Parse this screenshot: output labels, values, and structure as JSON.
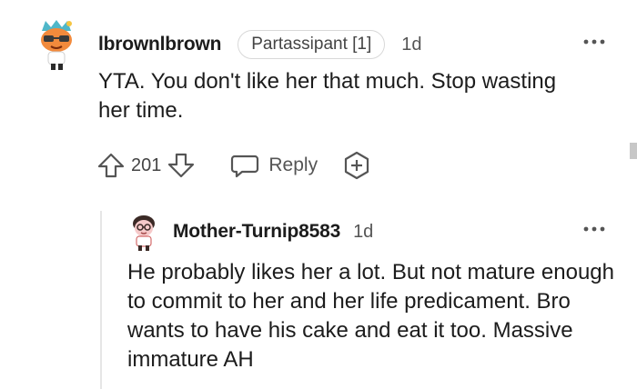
{
  "top_comment": {
    "author": "lbrownlbrown",
    "flair": "Partassipant [1]",
    "age": "1d",
    "body": "YTA. You don't like her that much. Stop wasting her time.",
    "upvote_icon": "arrow-up-outline-icon",
    "vote_count": "201",
    "downvote_icon": "arrow-down-outline-icon",
    "reply_icon": "speech-bubble-icon",
    "reply_label": "Reply",
    "award_icon": "award-plus-icon",
    "more_icon": "ellipsis-icon"
  },
  "reply_comment": {
    "author": "Mother-Turnip8583",
    "age": "1d",
    "body": "He probably likes her a lot. But not mature enough to commit to her and her life predicament. Bro wants to have his cake and eat it too. Massive immature AH",
    "more_icon": "ellipsis-icon"
  },
  "colors": {
    "text": "#1c1c1c",
    "muted": "#555555",
    "icon": "#555555",
    "thread_line": "#e6e6e6"
  }
}
